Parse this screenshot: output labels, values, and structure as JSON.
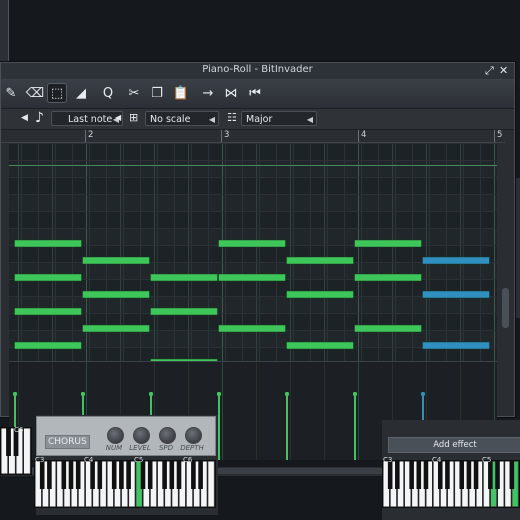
{
  "window": {
    "title": "Piano-Roll - BitInvader"
  },
  "optbar": {
    "note_len": "Last note",
    "scale": "No scale",
    "chord": "Major"
  },
  "timeline": {
    "bars": [
      "2",
      "3",
      "4",
      "5"
    ]
  },
  "chorus": {
    "name": "CHORUS",
    "knobs": [
      "NUM",
      "LEVEL",
      "SPD",
      "DEPTH"
    ]
  },
  "effects": {
    "add_effect": "Add effect"
  },
  "keyboards": {
    "left": {
      "labels": [
        "C6"
      ]
    },
    "middle": {
      "labels": [
        "C3",
        "C4",
        "C5",
        "C6"
      ]
    },
    "right": {
      "labels": [
        "C3",
        "C4",
        "C5"
      ]
    }
  },
  "colors": {
    "note_green": "#3fc65a",
    "note_blue": "#2f8fc1",
    "grid_bg": "#1e2327"
  },
  "notes": [
    {
      "color": "green",
      "start": 0.0,
      "len": 0.25,
      "row": 0
    },
    {
      "color": "green",
      "start": 0.0,
      "len": 0.25,
      "row": 2
    },
    {
      "color": "green",
      "start": 0.0,
      "len": 0.25,
      "row": 4
    },
    {
      "color": "green",
      "start": 0.0,
      "len": 0.25,
      "row": 6
    },
    {
      "color": "green",
      "start": 0.25,
      "len": 0.25,
      "row": 1
    },
    {
      "color": "green",
      "start": 0.25,
      "len": 0.25,
      "row": 3
    },
    {
      "color": "green",
      "start": 0.25,
      "len": 0.25,
      "row": 5
    },
    {
      "color": "green",
      "start": 0.5,
      "len": 0.25,
      "row": 2
    },
    {
      "color": "green",
      "start": 0.5,
      "len": 0.25,
      "row": 4
    },
    {
      "color": "green",
      "start": 0.5,
      "len": 0.25,
      "row": 7
    },
    {
      "color": "green",
      "start": 0.75,
      "len": 0.25,
      "row": 0
    },
    {
      "color": "green",
      "start": 0.75,
      "len": 0.25,
      "row": 2
    },
    {
      "color": "green",
      "start": 0.75,
      "len": 0.25,
      "row": 5
    },
    {
      "color": "green",
      "start": 1.0,
      "len": 0.25,
      "row": 1
    },
    {
      "color": "green",
      "start": 1.0,
      "len": 0.25,
      "row": 3
    },
    {
      "color": "green",
      "start": 1.0,
      "len": 0.25,
      "row": 6
    },
    {
      "color": "green",
      "start": 1.25,
      "len": 0.25,
      "row": 0
    },
    {
      "color": "green",
      "start": 1.25,
      "len": 0.25,
      "row": 2
    },
    {
      "color": "green",
      "start": 1.25,
      "len": 0.25,
      "row": 5
    },
    {
      "color": "blue",
      "start": 1.5,
      "len": 0.25,
      "row": 1
    },
    {
      "color": "blue",
      "start": 1.5,
      "len": 0.25,
      "row": 3
    },
    {
      "color": "blue",
      "start": 1.5,
      "len": 0.25,
      "row": 6
    }
  ]
}
